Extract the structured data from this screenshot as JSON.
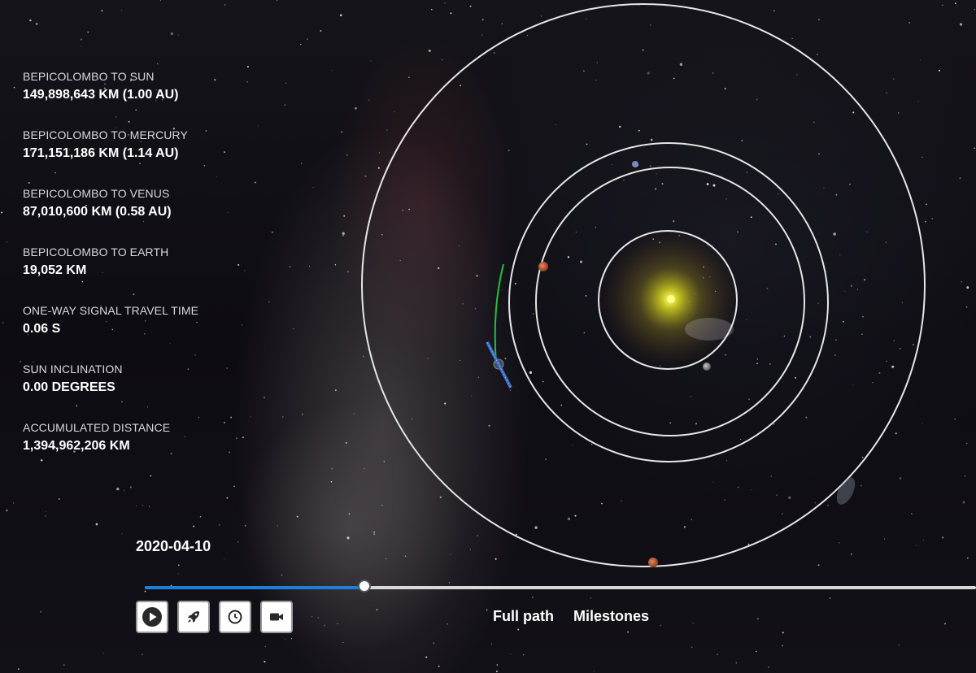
{
  "stats": [
    {
      "label": "BEPICOLOMBO TO SUN",
      "value": "149,898,643 KM (1.00 AU)"
    },
    {
      "label": "BEPICOLOMBO TO MERCURY",
      "value": "171,151,186 KM (1.14 AU)"
    },
    {
      "label": "BEPICOLOMBO TO VENUS",
      "value": "87,010,600 KM (0.58 AU)"
    },
    {
      "label": "BEPICOLOMBO TO EARTH",
      "value": "19,052 KM"
    },
    {
      "label": "ONE-WAY SIGNAL TRAVEL TIME",
      "value": "0.06 S"
    },
    {
      "label": "SUN INCLINATION",
      "value": "0.00 DEGREES"
    },
    {
      "label": "ACCUMULATED DISTANCE",
      "value": "1,394,962,206 KM"
    }
  ],
  "timeline": {
    "date": "2020-04-10",
    "progress": 0.265
  },
  "controls": [
    {
      "name": "play-button",
      "icon": "play-icon"
    },
    {
      "name": "spacecraft-view-button",
      "icon": "rocket-icon"
    },
    {
      "name": "time-button",
      "icon": "clock-icon"
    },
    {
      "name": "camera-button",
      "icon": "video-camera-icon"
    }
  ],
  "links": {
    "full_path": "Full path",
    "milestones": "Milestones"
  },
  "colors": {
    "timeline_fill": "#1f7fd8",
    "timeline_track": "#d8d8d8",
    "orbit_line": "#e6e6e6",
    "trajectory": "#22c23a",
    "sun_core": "#ffff80"
  }
}
